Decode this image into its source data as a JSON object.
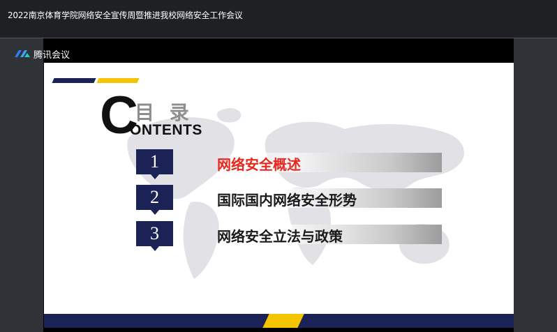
{
  "window": {
    "title": "2022南京体育学院网络安全宣传周暨推进我校网络安全工作会议"
  },
  "app": {
    "name": "腾讯会议",
    "logo_icon": "tencent-meeting-logo"
  },
  "slide": {
    "heading_cn": "目 录",
    "heading_big_letter": "C",
    "heading_en": "ONTENTS",
    "items": [
      {
        "number": "1",
        "label": "网络安全概述",
        "color": "#e8281d"
      },
      {
        "number": "2",
        "label": "国际国内网络安全形势",
        "color": "#1a1a1a"
      },
      {
        "number": "3",
        "label": "网络安全立法与政策",
        "color": "#1a1a1a"
      }
    ],
    "colors": {
      "navy": "#1b2356",
      "gold": "#f5c400"
    }
  }
}
